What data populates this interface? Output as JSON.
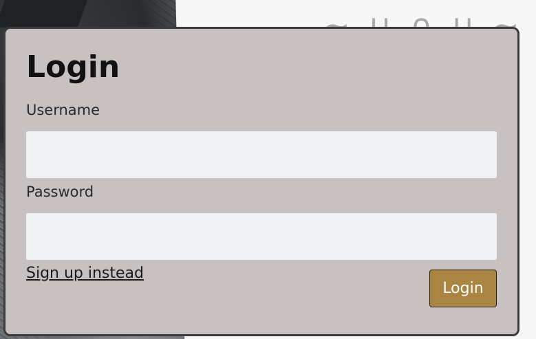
{
  "form": {
    "title": "Login",
    "username_label": "Username",
    "username_value": "",
    "password_label": "Password",
    "password_value": "",
    "signup_link": "Sign up instead",
    "submit_label": "Login"
  },
  "colors": {
    "card_background": "#c7c2c1",
    "card_border": "#3b3b3b",
    "input_background": "#f1f2f4",
    "button_background": "#a98541",
    "button_text": "#ffffff"
  }
}
